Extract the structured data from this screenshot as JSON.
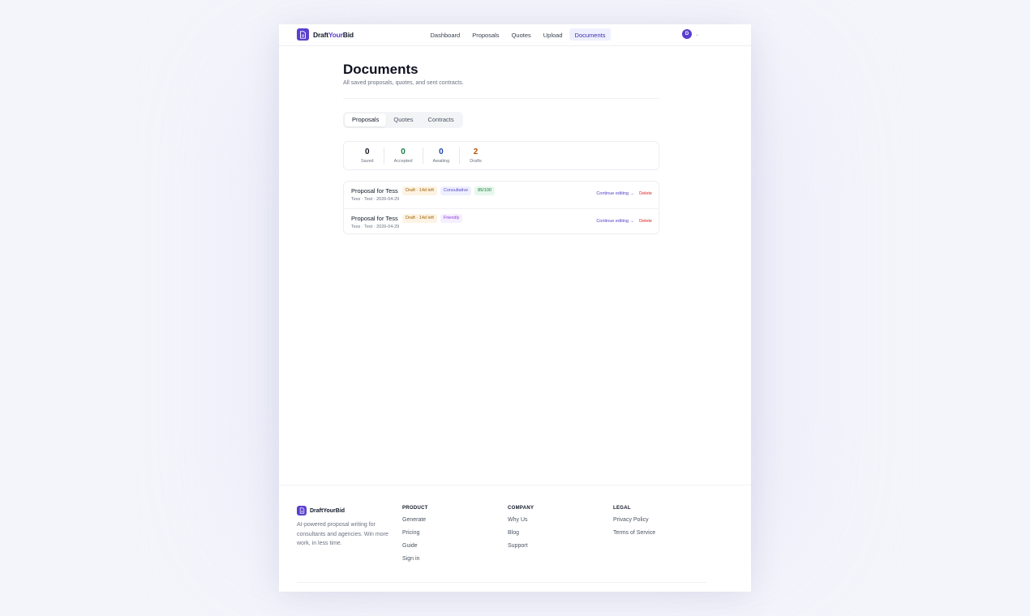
{
  "header": {
    "logo": {
      "part1": "Draft",
      "part2": "Your",
      "part3": "Bid"
    },
    "nav": [
      {
        "label": "Dashboard",
        "active": false
      },
      {
        "label": "Proposals",
        "active": false
      },
      {
        "label": "Quotes",
        "active": false
      },
      {
        "label": "Upload",
        "active": false
      },
      {
        "label": "Documents",
        "active": true
      }
    ],
    "user_initial": "D"
  },
  "page": {
    "title": "Documents",
    "subtitle": "All saved proposals, quotes, and sent contracts."
  },
  "tabs": [
    {
      "label": "Proposals",
      "active": true
    },
    {
      "label": "Quotes",
      "active": false
    },
    {
      "label": "Contracts",
      "active": false
    }
  ],
  "stats": [
    {
      "value": "0",
      "label": "Saved",
      "color": "#111827"
    },
    {
      "value": "0",
      "label": "Accepted",
      "color": "#15803d"
    },
    {
      "value": "0",
      "label": "Awaiting",
      "color": "#1e40af"
    },
    {
      "value": "2",
      "label": "Drafts",
      "color": "#b45309"
    }
  ],
  "documents": [
    {
      "title": "Proposal for Tess",
      "status": "Draft · 14d left",
      "tone": "Consultative",
      "score": "85/100",
      "meta": "Tess · Test · 2026-04-29",
      "edit": "Continue editing →",
      "delete": "Delete"
    },
    {
      "title": "Proposal for Tess",
      "status": "Draft · 14d left",
      "tone": "Friendly",
      "meta": "Tess · Test · 2026-04-29",
      "edit": "Continue editing →",
      "delete": "Delete"
    }
  ],
  "footer": {
    "brand": "DraftYourBid",
    "description": "AI-powered proposal writing for consultants and agencies. Win more work, in less time.",
    "product": {
      "heading": "PRODUCT",
      "links": [
        "Generate",
        "Pricing",
        "Guide",
        "Sign in"
      ]
    },
    "company": {
      "heading": "COMPANY",
      "links": [
        "Why Us",
        "Blog",
        "Support"
      ]
    },
    "legal": {
      "heading": "LEGAL",
      "links": [
        "Privacy Policy",
        "Terms of Service"
      ]
    }
  },
  "colors": {
    "accent": "#5b3fd0",
    "danger": "#dc2626",
    "success": "#15803d"
  }
}
